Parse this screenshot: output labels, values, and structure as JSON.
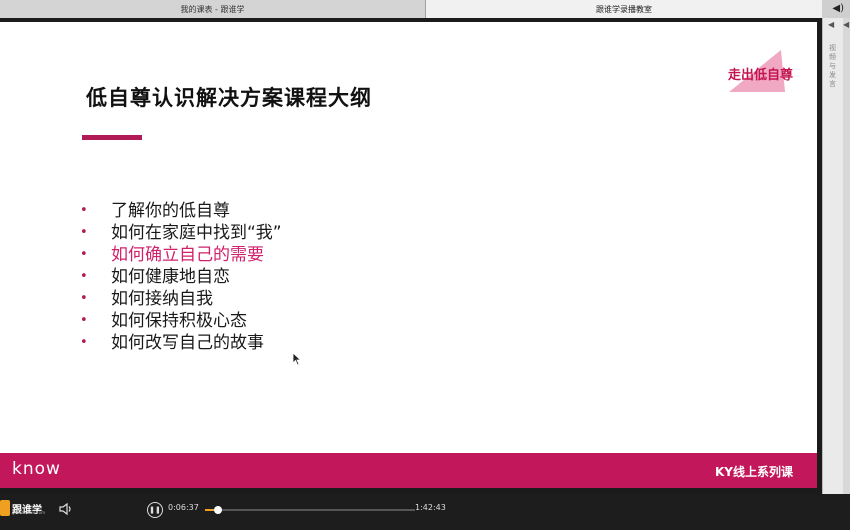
{
  "tabs": [
    {
      "label": "我的课表 - 跟谁学"
    },
    {
      "label": "跟谁学录播教室"
    }
  ],
  "slide": {
    "title": "低自尊认识解决方案课程大纲",
    "tag": "走出低自尊",
    "bullets": [
      {
        "text": "了解你的低自尊",
        "highlight": false
      },
      {
        "text": "如何在家庭中找到“我”",
        "highlight": false
      },
      {
        "text": "如何确立自己的需要",
        "highlight": true
      },
      {
        "text": "如何健康地自恋",
        "highlight": false
      },
      {
        "text": "如何接纳自我",
        "highlight": false
      },
      {
        "text": "如何保持积极心态",
        "highlight": false
      },
      {
        "text": "如何改写自己的故事",
        "highlight": false
      }
    ],
    "footer_brand": "know",
    "footer_series": "KY线上系列课"
  },
  "side_panel": {
    "text": "视频与发言"
  },
  "player": {
    "logo_text": "跟谁学",
    "logo_sub": "genshuixue.com",
    "current_time": "0:06:37",
    "total_time": "1:42:43",
    "progress": 0.064
  },
  "colors": {
    "accent": "#c2185b",
    "highlight": "#d0206b",
    "progress": "#f0a020"
  }
}
